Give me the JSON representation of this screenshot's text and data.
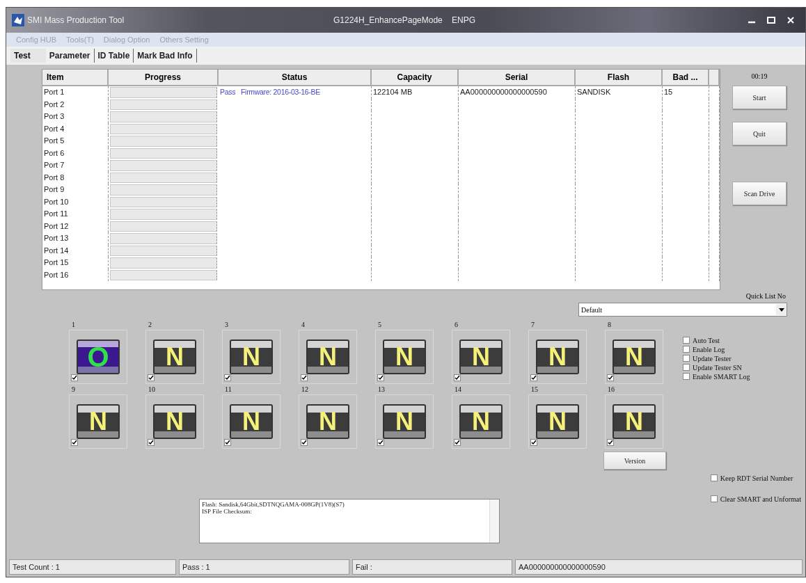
{
  "window": {
    "title": "SMI Mass Production Tool",
    "subtitle": "G1224H_EnhancePageMode",
    "mode": "ENPG"
  },
  "menu": [
    "Config HUB",
    "Tools(T)",
    "Dialog Option",
    "Others Setting"
  ],
  "tabs": [
    {
      "label": "Test",
      "selected": true
    },
    {
      "label": "Parameter",
      "selected": false
    },
    {
      "label": "ID Table",
      "selected": false
    },
    {
      "label": "Mark Bad Info",
      "selected": false
    }
  ],
  "table": {
    "columns": [
      "Item",
      "Progress",
      "Status",
      "Capacity",
      "Serial",
      "Flash",
      "Bad ..."
    ],
    "rows": [
      {
        "item": "Port 1",
        "level": 0,
        "status": "Pass   Firmware: 2016-03-16-BE",
        "capacity": "122104 MB",
        "serial": "AA000000000000000590",
        "flash": "SANDISK",
        "bad": "15"
      },
      {
        "item": "Port 2",
        "level": 0
      },
      {
        "item": "Port 3",
        "level": 0
      },
      {
        "item": "Port 4",
        "level": 0
      },
      {
        "item": "Port 5",
        "level": 0
      },
      {
        "item": "Port 6",
        "level": 0
      },
      {
        "item": "Port 7",
        "level": 0
      },
      {
        "item": "Port 8",
        "level": 0
      },
      {
        "item": "Port 9",
        "level": 0
      },
      {
        "item": "Port 10",
        "level": 0
      },
      {
        "item": "Port 11",
        "level": 0
      },
      {
        "item": "Port 12",
        "level": 0
      },
      {
        "item": "Port 13",
        "level": 0
      },
      {
        "item": "Port 14",
        "level": 0
      },
      {
        "item": "Port 15",
        "level": 0
      },
      {
        "item": "Port 16",
        "level": 0
      }
    ]
  },
  "timer": "00:19",
  "buttons": [
    "Start",
    "Quit",
    "Scan Drive"
  ],
  "quick_list": {
    "label": "Quick List No",
    "value": "Default"
  },
  "ports": [
    {
      "number": "1",
      "kind": "pass",
      "mark": "O",
      "checked": true
    },
    {
      "number": "2",
      "kind": "none",
      "mark": "N",
      "checked": true
    },
    {
      "number": "3",
      "kind": "none",
      "mark": "N",
      "checked": true
    },
    {
      "number": "4",
      "kind": "none",
      "mark": "N",
      "checked": true
    },
    {
      "number": "5",
      "kind": "none",
      "mark": "N",
      "checked": true
    },
    {
      "number": "6",
      "kind": "none",
      "mark": "N",
      "checked": true
    },
    {
      "number": "7",
      "kind": "none",
      "mark": "N",
      "checked": true
    },
    {
      "number": "8",
      "kind": "none",
      "mark": "N",
      "checked": true
    },
    {
      "number": "9",
      "kind": "none",
      "mark": "N",
      "checked": true
    },
    {
      "number": "10",
      "kind": "none",
      "mark": "N",
      "checked": true
    },
    {
      "number": "11",
      "kind": "none",
      "mark": "N",
      "checked": true
    },
    {
      "number": "12",
      "kind": "none",
      "mark": "N",
      "checked": true
    },
    {
      "number": "13",
      "kind": "none",
      "mark": "N",
      "checked": true
    },
    {
      "number": "14",
      "kind": "none",
      "mark": "N",
      "checked": true
    },
    {
      "number": "15",
      "kind": "none",
      "mark": "N",
      "checked": true
    },
    {
      "number": "16",
      "kind": "none",
      "mark": "N",
      "checked": true
    }
  ],
  "options": [
    {
      "label": "Auto Test",
      "checked": false
    },
    {
      "label": "Enable Log",
      "checked": false
    },
    {
      "label": "Update Tester",
      "checked": false
    },
    {
      "label": "Update Tester SN",
      "checked": false
    },
    {
      "label": "Enable SMART Log",
      "checked": false
    }
  ],
  "version_button": "Version",
  "extra_options": [
    {
      "label": "Keep RDT Serial Number",
      "checked": false
    },
    {
      "label": "Clear SMART and Unformat",
      "checked": false
    }
  ],
  "log": [
    "Flash: Sandisk,64Gbit,SDTNQGAMA-008GP(1V8)(S7)",
    "ISP File Checksum:"
  ],
  "status_bar": [
    "Test Count : 1",
    "Pass : 1",
    "Fail :",
    "AA000000000000000590"
  ]
}
